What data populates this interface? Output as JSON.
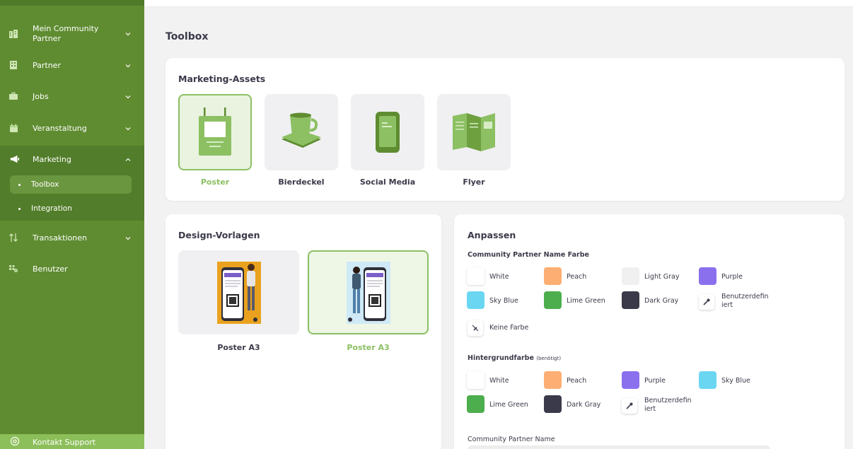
{
  "sidebar": {
    "items": [
      {
        "label": "Mein Community Partner",
        "icon": "building-icon"
      },
      {
        "label": "Partner",
        "icon": "office-icon"
      },
      {
        "label": "Jobs",
        "icon": "briefcase-icon"
      },
      {
        "label": "Veranstaltung",
        "icon": "calendar-icon"
      },
      {
        "label": "Marketing",
        "icon": "megaphone-icon"
      },
      {
        "label": "Transaktionen",
        "icon": "transfer-arrows-icon"
      },
      {
        "label": "Benutzer",
        "icon": "users-gear-icon"
      }
    ],
    "marketing_sub": [
      {
        "label": "Toolbox",
        "active": true
      },
      {
        "label": "Integration",
        "active": false
      }
    ],
    "support_label": "Kontakt Support",
    "colors": {
      "sidebar": "#5f8c31",
      "accent": "#8cc063"
    }
  },
  "page": {
    "title": "Toolbox"
  },
  "marketing_assets": {
    "title": "Marketing-Assets",
    "items": [
      {
        "label": "Poster",
        "icon": "poster-icon",
        "selected": true
      },
      {
        "label": "Bierdeckel",
        "icon": "coaster-cup-icon",
        "selected": false
      },
      {
        "label": "Social Media",
        "icon": "phone-icon",
        "selected": false
      },
      {
        "label": "Flyer",
        "icon": "flyer-icon",
        "selected": false
      }
    ]
  },
  "design_templates": {
    "title": "Design-Vorlagen",
    "items": [
      {
        "label": "Poster A3",
        "selected": false
      },
      {
        "label": "Poster A3",
        "selected": true
      }
    ]
  },
  "customize": {
    "title": "Anpassen",
    "name_color": {
      "label": "Community Partner Name Farbe",
      "options": [
        {
          "label": "White",
          "color": "#ffffff"
        },
        {
          "label": "Peach",
          "color": "#fdae72"
        },
        {
          "label": "Light Gray",
          "color": "#f0f0f0"
        },
        {
          "label": "Purple",
          "color": "#8b70ee"
        },
        {
          "label": "Sky Blue",
          "color": "#6ad6f2"
        },
        {
          "label": "Lime Green",
          "color": "#4cae4c"
        },
        {
          "label": "Dark Gray",
          "color": "#3a3a4a"
        },
        {
          "label": "Benutzerdefin iert",
          "icon": "eyedropper-icon"
        },
        {
          "label": "Keine Farbe",
          "icon": "no-color-icon"
        }
      ]
    },
    "background_color": {
      "label": "Hintergrundfarbe",
      "required": "(benötigt)",
      "options": [
        {
          "label": "White",
          "color": "#ffffff"
        },
        {
          "label": "Peach",
          "color": "#fdae72"
        },
        {
          "label": "Purple",
          "color": "#8b70ee"
        },
        {
          "label": "Sky Blue",
          "color": "#6ad6f2"
        },
        {
          "label": "Lime Green",
          "color": "#4cae4c"
        },
        {
          "label": "Dark Gray",
          "color": "#3a3a4a"
        },
        {
          "label": "Benutzerdefin iert",
          "icon": "eyedropper-icon"
        }
      ]
    },
    "name_field": {
      "label": "Community Partner Name",
      "value": ""
    }
  }
}
